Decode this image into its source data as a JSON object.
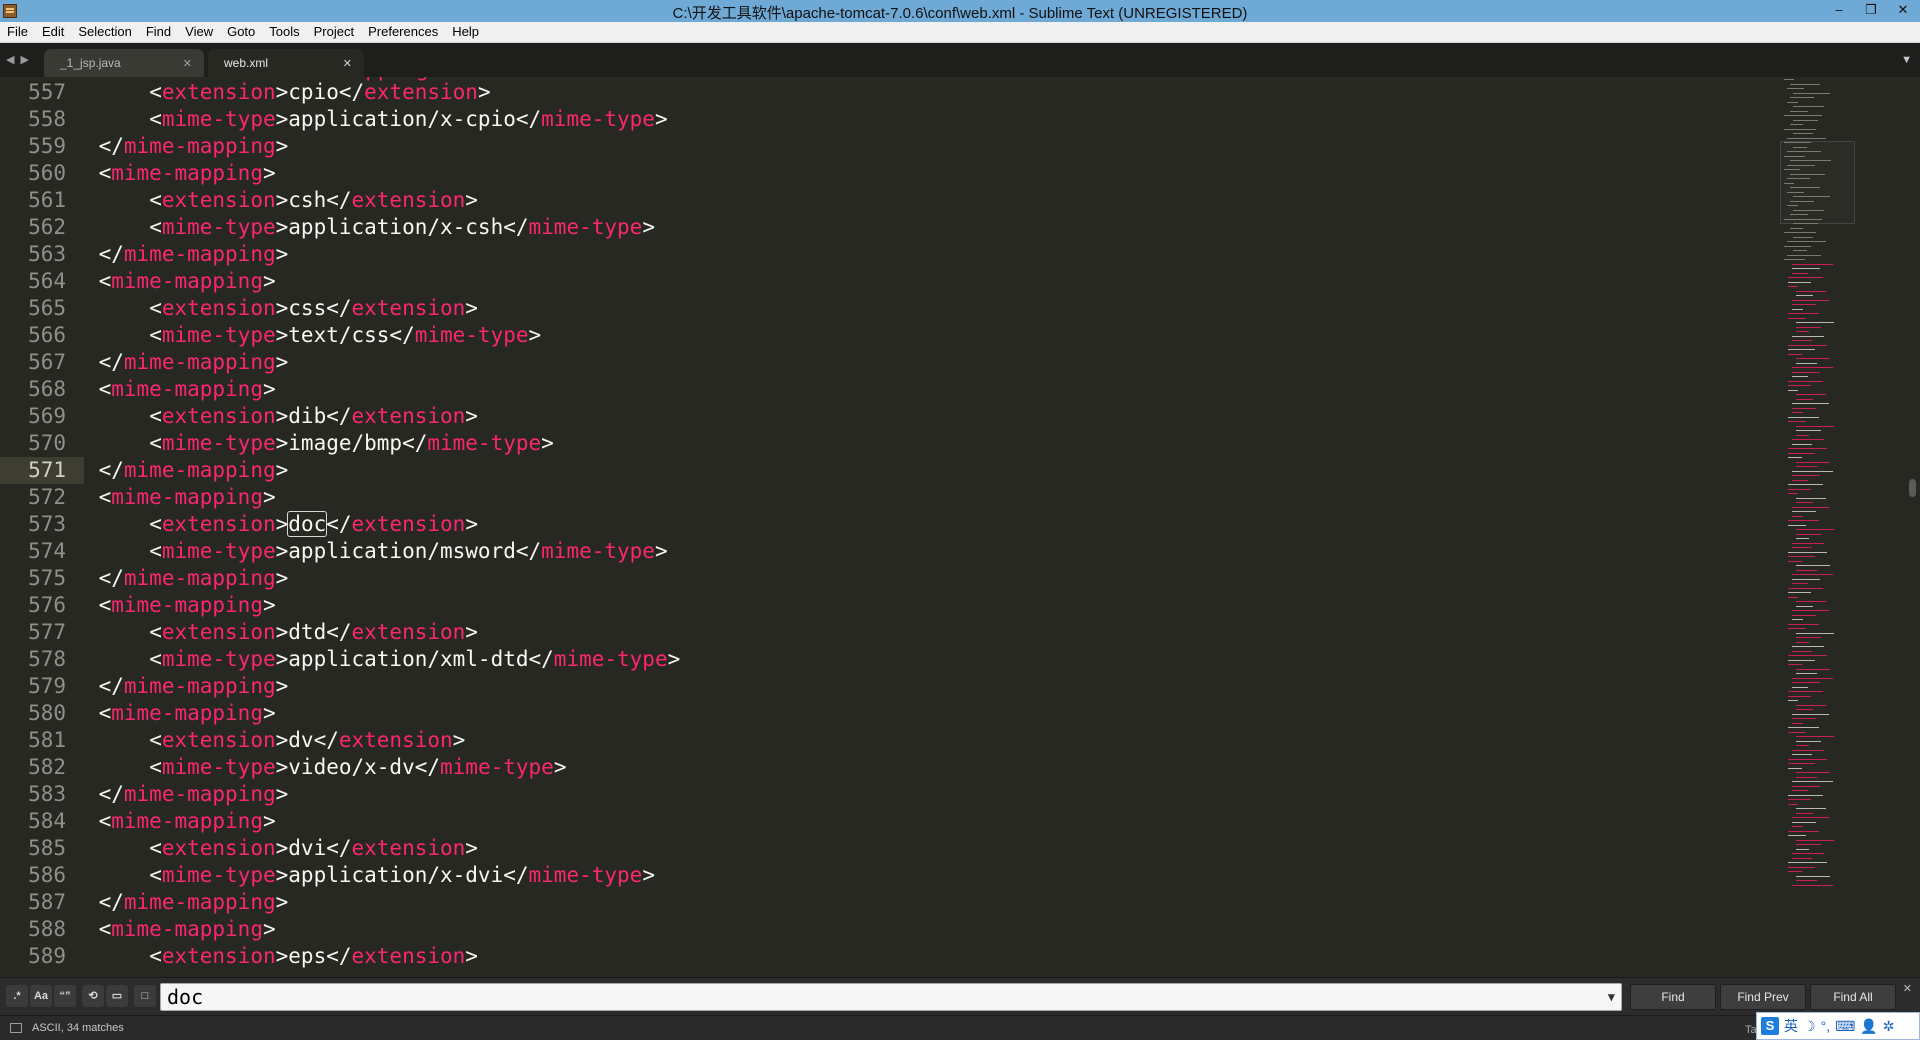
{
  "window": {
    "title": "C:\\开发工具软件\\apache-tomcat-7.0.6\\conf\\web.xml - Sublime Text (UNREGISTERED)",
    "controls": [
      "–",
      "❐",
      "✕"
    ]
  },
  "menu": [
    "File",
    "Edit",
    "Selection",
    "Find",
    "View",
    "Goto",
    "Tools",
    "Project",
    "Preferences",
    "Help"
  ],
  "tabs": [
    {
      "label": "_1_jsp.java",
      "active": false
    },
    {
      "label": "web.xml",
      "active": true
    }
  ],
  "editor": {
    "active_line": 571,
    "partial_top": "mapping",
    "lines": [
      {
        "n": "557",
        "indent": 2,
        "parts": [
          [
            "p",
            "<"
          ],
          [
            "t",
            "extension"
          ],
          [
            "p",
            ">cpio</"
          ],
          [
            "t",
            "extension"
          ],
          [
            "p",
            ">"
          ]
        ]
      },
      {
        "n": "558",
        "indent": 2,
        "parts": [
          [
            "p",
            "<"
          ],
          [
            "t",
            "mime-type"
          ],
          [
            "p",
            ">application/x-cpio</"
          ],
          [
            "t",
            "mime-type"
          ],
          [
            "p",
            ">"
          ]
        ]
      },
      {
        "n": "559",
        "indent": 1,
        "parts": [
          [
            "p",
            "</"
          ],
          [
            "t",
            "mime-mapping"
          ],
          [
            "p",
            ">"
          ]
        ]
      },
      {
        "n": "560",
        "indent": 1,
        "parts": [
          [
            "p",
            "<"
          ],
          [
            "t",
            "mime-mapping"
          ],
          [
            "p",
            ">"
          ]
        ]
      },
      {
        "n": "561",
        "indent": 2,
        "parts": [
          [
            "p",
            "<"
          ],
          [
            "t",
            "extension"
          ],
          [
            "p",
            ">csh</"
          ],
          [
            "t",
            "extension"
          ],
          [
            "p",
            ">"
          ]
        ]
      },
      {
        "n": "562",
        "indent": 2,
        "parts": [
          [
            "p",
            "<"
          ],
          [
            "t",
            "mime-type"
          ],
          [
            "p",
            ">application/x-csh</"
          ],
          [
            "t",
            "mime-type"
          ],
          [
            "p",
            ">"
          ]
        ]
      },
      {
        "n": "563",
        "indent": 1,
        "parts": [
          [
            "p",
            "</"
          ],
          [
            "t",
            "mime-mapping"
          ],
          [
            "p",
            ">"
          ]
        ]
      },
      {
        "n": "564",
        "indent": 1,
        "parts": [
          [
            "p",
            "<"
          ],
          [
            "t",
            "mime-mapping"
          ],
          [
            "p",
            ">"
          ]
        ]
      },
      {
        "n": "565",
        "indent": 2,
        "parts": [
          [
            "p",
            "<"
          ],
          [
            "t",
            "extension"
          ],
          [
            "p",
            ">css</"
          ],
          [
            "t",
            "extension"
          ],
          [
            "p",
            ">"
          ]
        ]
      },
      {
        "n": "566",
        "indent": 2,
        "parts": [
          [
            "p",
            "<"
          ],
          [
            "t",
            "mime-type"
          ],
          [
            "p",
            ">text/css</"
          ],
          [
            "t",
            "mime-type"
          ],
          [
            "p",
            ">"
          ]
        ]
      },
      {
        "n": "567",
        "indent": 1,
        "parts": [
          [
            "p",
            "</"
          ],
          [
            "t",
            "mime-mapping"
          ],
          [
            "p",
            ">"
          ]
        ]
      },
      {
        "n": "568",
        "indent": 1,
        "parts": [
          [
            "p",
            "<"
          ],
          [
            "t",
            "mime-mapping"
          ],
          [
            "p",
            ">"
          ]
        ]
      },
      {
        "n": "569",
        "indent": 2,
        "parts": [
          [
            "p",
            "<"
          ],
          [
            "t",
            "extension"
          ],
          [
            "p",
            ">dib</"
          ],
          [
            "t",
            "extension"
          ],
          [
            "p",
            ">"
          ]
        ]
      },
      {
        "n": "570",
        "indent": 2,
        "parts": [
          [
            "p",
            "<"
          ],
          [
            "t",
            "mime-type"
          ],
          [
            "p",
            ">image/bmp</"
          ],
          [
            "t",
            "mime-type"
          ],
          [
            "p",
            ">"
          ]
        ]
      },
      {
        "n": "571",
        "indent": 1,
        "parts": [
          [
            "p",
            "</"
          ],
          [
            "t",
            "mime-mapping"
          ],
          [
            "p",
            ">"
          ]
        ]
      },
      {
        "n": "572",
        "indent": 1,
        "parts": [
          [
            "p",
            "<"
          ],
          [
            "t",
            "mime-mapping"
          ],
          [
            "p",
            ">"
          ]
        ]
      },
      {
        "n": "573",
        "indent": 2,
        "parts": [
          [
            "p",
            "<"
          ],
          [
            "t",
            "extension"
          ],
          [
            "p",
            ">"
          ],
          [
            "m",
            "doc"
          ],
          [
            "p",
            "</"
          ],
          [
            "t",
            "extension"
          ],
          [
            "p",
            ">"
          ]
        ]
      },
      {
        "n": "574",
        "indent": 2,
        "parts": [
          [
            "p",
            "<"
          ],
          [
            "t",
            "mime-type"
          ],
          [
            "p",
            ">application/msword</"
          ],
          [
            "t",
            "mime-type"
          ],
          [
            "p",
            ">"
          ]
        ]
      },
      {
        "n": "575",
        "indent": 1,
        "parts": [
          [
            "p",
            "</"
          ],
          [
            "t",
            "mime-mapping"
          ],
          [
            "p",
            ">"
          ]
        ]
      },
      {
        "n": "576",
        "indent": 1,
        "parts": [
          [
            "p",
            "<"
          ],
          [
            "t",
            "mime-mapping"
          ],
          [
            "p",
            ">"
          ]
        ]
      },
      {
        "n": "577",
        "indent": 2,
        "parts": [
          [
            "p",
            "<"
          ],
          [
            "t",
            "extension"
          ],
          [
            "p",
            ">dtd</"
          ],
          [
            "t",
            "extension"
          ],
          [
            "p",
            ">"
          ]
        ]
      },
      {
        "n": "578",
        "indent": 2,
        "parts": [
          [
            "p",
            "<"
          ],
          [
            "t",
            "mime-type"
          ],
          [
            "p",
            ">application/xml-dtd</"
          ],
          [
            "t",
            "mime-type"
          ],
          [
            "p",
            ">"
          ]
        ]
      },
      {
        "n": "579",
        "indent": 1,
        "parts": [
          [
            "p",
            "</"
          ],
          [
            "t",
            "mime-mapping"
          ],
          [
            "p",
            ">"
          ]
        ]
      },
      {
        "n": "580",
        "indent": 1,
        "parts": [
          [
            "p",
            "<"
          ],
          [
            "t",
            "mime-mapping"
          ],
          [
            "p",
            ">"
          ]
        ]
      },
      {
        "n": "581",
        "indent": 2,
        "parts": [
          [
            "p",
            "<"
          ],
          [
            "t",
            "extension"
          ],
          [
            "p",
            ">dv</"
          ],
          [
            "t",
            "extension"
          ],
          [
            "p",
            ">"
          ]
        ]
      },
      {
        "n": "582",
        "indent": 2,
        "parts": [
          [
            "p",
            "<"
          ],
          [
            "t",
            "mime-type"
          ],
          [
            "p",
            ">video/x-dv</"
          ],
          [
            "t",
            "mime-type"
          ],
          [
            "p",
            ">"
          ]
        ]
      },
      {
        "n": "583",
        "indent": 1,
        "parts": [
          [
            "p",
            "</"
          ],
          [
            "t",
            "mime-mapping"
          ],
          [
            "p",
            ">"
          ]
        ]
      },
      {
        "n": "584",
        "indent": 1,
        "parts": [
          [
            "p",
            "<"
          ],
          [
            "t",
            "mime-mapping"
          ],
          [
            "p",
            ">"
          ]
        ]
      },
      {
        "n": "585",
        "indent": 2,
        "parts": [
          [
            "p",
            "<"
          ],
          [
            "t",
            "extension"
          ],
          [
            "p",
            ">dvi</"
          ],
          [
            "t",
            "extension"
          ],
          [
            "p",
            ">"
          ]
        ]
      },
      {
        "n": "586",
        "indent": 2,
        "parts": [
          [
            "p",
            "<"
          ],
          [
            "t",
            "mime-type"
          ],
          [
            "p",
            ">application/x-dvi</"
          ],
          [
            "t",
            "mime-type"
          ],
          [
            "p",
            ">"
          ]
        ]
      },
      {
        "n": "587",
        "indent": 1,
        "parts": [
          [
            "p",
            "</"
          ],
          [
            "t",
            "mime-mapping"
          ],
          [
            "p",
            ">"
          ]
        ]
      },
      {
        "n": "588",
        "indent": 1,
        "parts": [
          [
            "p",
            "<"
          ],
          [
            "t",
            "mime-mapping"
          ],
          [
            "p",
            ">"
          ]
        ]
      },
      {
        "n": "589",
        "indent": 2,
        "parts": [
          [
            "p",
            "<"
          ],
          [
            "t",
            "extension"
          ],
          [
            "p",
            ">eps</"
          ],
          [
            "t",
            "extension"
          ],
          [
            "p",
            ">"
          ]
        ]
      }
    ]
  },
  "find_panel": {
    "options": [
      {
        "name": "regex-toggle",
        "glyph": ".*"
      },
      {
        "name": "case-sensitive-toggle",
        "glyph": "Aa"
      },
      {
        "name": "whole-word-toggle",
        "glyph": "“”"
      },
      {
        "name": "wrap-toggle",
        "glyph": "⟲"
      },
      {
        "name": "in-selection-toggle",
        "glyph": "▭"
      },
      {
        "name": "highlight-matches-toggle",
        "glyph": "□"
      }
    ],
    "query": "doc",
    "buttons": {
      "find": "Find",
      "find_prev": "Find Prev",
      "find_all": "Find All"
    },
    "close": "✕"
  },
  "status": {
    "text": "ASCII, 34 matches",
    "tab_size": "Ta"
  },
  "ime": {
    "logo": "S",
    "lang": "英",
    "icons": [
      "moon-icon",
      "punctuation-icon",
      "keyboard-icon",
      "user-icon",
      "settings-icon"
    ],
    "glyphs": [
      "☽",
      "°,",
      "⌨",
      "👤",
      "✲"
    ]
  },
  "colors": {
    "background": "#272822",
    "tag": "#f92672",
    "text": "#f8f8f2",
    "line_number": "#8f908a",
    "titlebar": "#6fa9d6"
  }
}
